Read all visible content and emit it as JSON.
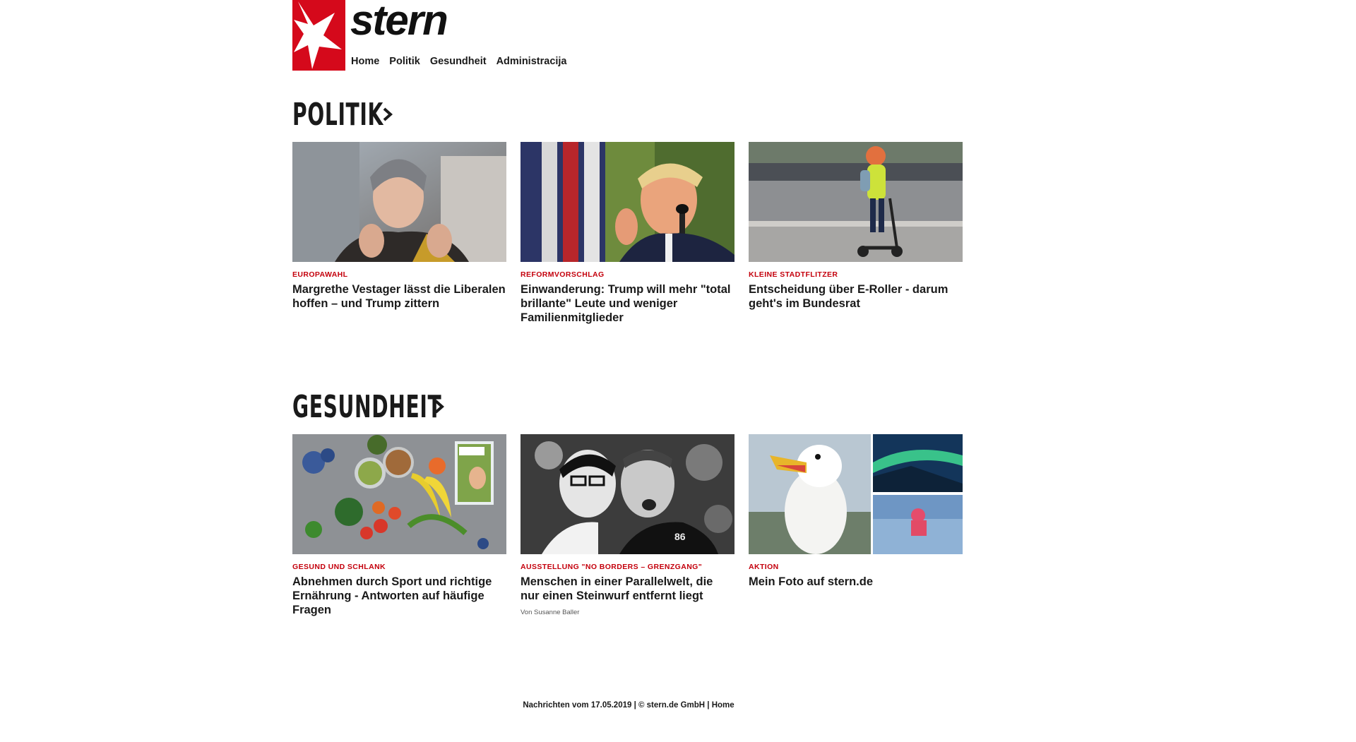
{
  "header": {
    "logo_text": "stern",
    "nav": [
      "Home",
      "Politik",
      "Gesundheit",
      "Administracija"
    ]
  },
  "sections": [
    {
      "title": "POLITIK",
      "cards": [
        {
          "kicker": "EUROPAWAHL",
          "headline": "Margrethe Vestager lässt die Liberalen hoffen – und Trump zittern",
          "image": "woman-laughing-photo"
        },
        {
          "kicker": "REFORMVORSCHLAG",
          "headline": "Einwanderung: Trump will mehr \"total brillante\" Leute und weniger Familienmitglieder",
          "image": "trump-speaking-photo"
        },
        {
          "kicker": "KLEINE STADTFLITZER",
          "headline": "Entscheidung über E-Roller - darum geht's im Bundesrat",
          "image": "e-scooter-rider-photo"
        }
      ]
    },
    {
      "title": "GESUNDHEIT",
      "cards": [
        {
          "kicker": "GESUND UND SCHLANK",
          "headline": "Abnehmen durch Sport und richtige Ernährung - Antworten auf häufige Fragen",
          "image": "vegetables-magazine-photo"
        },
        {
          "kicker": "AUSSTELLUNG \"NO BORDERS – GRENZGANG\"",
          "headline": "Menschen in einer Parallelwelt, die nur einen Steinwurf entfernt liegt",
          "author": "Von Susanne Baller",
          "image": "two-men-bw-photo"
        },
        {
          "kicker": "AKTION",
          "headline": "Mein Foto auf stern.de",
          "image": "seagull-collage-photo"
        }
      ]
    }
  ],
  "footer": {
    "text": "Nachrichten vom 17.05.2019 | © stern.de GmbH | Home"
  },
  "colors": {
    "brand_red": "#d5091b",
    "kicker_red": "#c4000c",
    "text": "#1a1a1a"
  }
}
